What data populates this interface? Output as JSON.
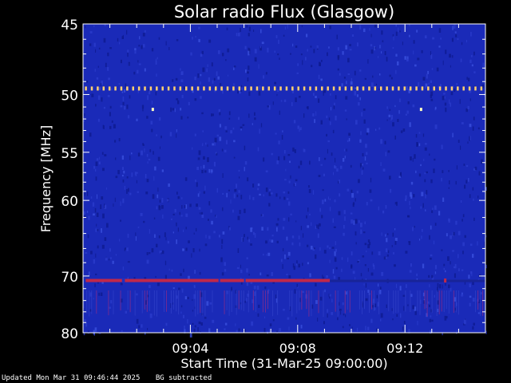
{
  "chart_data": {
    "type": "heatmap",
    "title": "Solar radio Flux (Glasgow)",
    "xlabel": "Start Time (31-Mar-25 09:00:00)",
    "ylabel": "Frequency [MHz]",
    "x_unit": "minutes after 09:00",
    "xlim": [
      0,
      15
    ],
    "x_ticks": [
      {
        "value": 4,
        "label": "09:04"
      },
      {
        "value": 8,
        "label": "09:08"
      },
      {
        "value": 12,
        "label": "09:12"
      }
    ],
    "y_scale": "reciprocal",
    "ylim": [
      45,
      80
    ],
    "y_ticks": [
      {
        "value": 45,
        "label": "45"
      },
      {
        "value": 50,
        "label": "50"
      },
      {
        "value": 55,
        "label": "55"
      },
      {
        "value": 60,
        "label": "60"
      },
      {
        "value": 70,
        "label": "70"
      },
      {
        "value": 80,
        "label": "80"
      }
    ],
    "colors": {
      "background": "#1a2ab8",
      "interference_line": "#ffd070",
      "band_70mhz": "#c0284a",
      "spikes": "#8a2a8a"
    },
    "features": [
      {
        "name": "interference-line",
        "frequency": 49.5,
        "start": 0,
        "end": 15
      },
      {
        "name": "interference-dot",
        "frequency": 51.2,
        "time": 2.6
      },
      {
        "name": "interference-dot",
        "frequency": 51.2,
        "time": 12.6
      },
      {
        "name": "band",
        "frequency": 70.7,
        "start": 0.1,
        "end": 9.2
      },
      {
        "name": "band-dot",
        "frequency": 70.7,
        "time": 13.5
      }
    ],
    "grid": false
  },
  "footer": {
    "updated": "Updated Mon Mar 31 09:46:44 2025",
    "note": "BG subtracted"
  }
}
